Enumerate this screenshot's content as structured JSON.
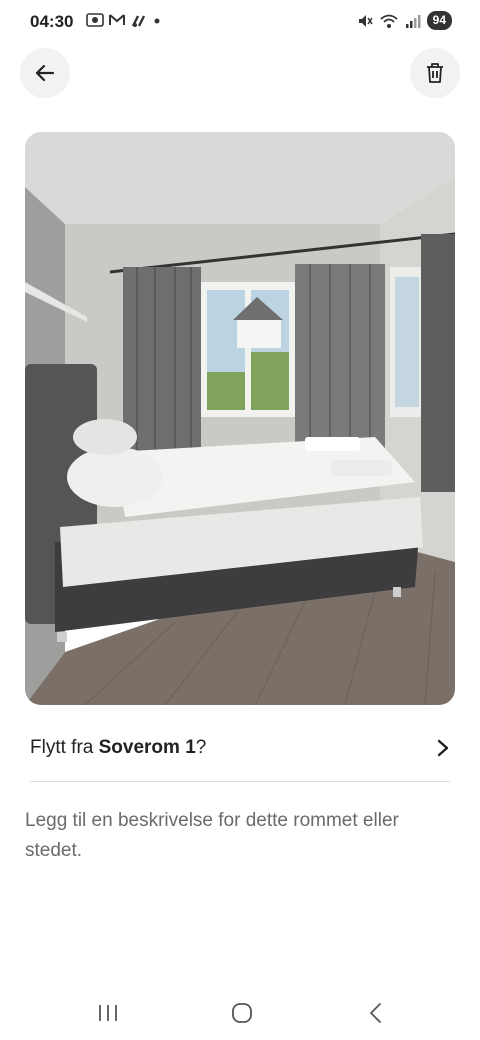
{
  "status_bar": {
    "time": "04:30",
    "battery": "94",
    "icons": [
      "screenshot-icon",
      "gmail-icon",
      "music-icon",
      "dot-icon",
      "mute-icon",
      "wifi-icon",
      "signal-icon",
      "battery-icon"
    ]
  },
  "header": {
    "back_icon": "arrow-left-icon",
    "delete_icon": "trash-icon"
  },
  "photo": {
    "subject": "bedroom-photo"
  },
  "move_row": {
    "prefix": "Flytt fra ",
    "room": "Soverom 1",
    "suffix": "?",
    "icon": "chevron-right-icon"
  },
  "description": {
    "placeholder": "Legg til en beskrivelse for dette rommet eller stedet."
  },
  "nav_bar": {
    "icons": [
      "recent-apps-icon",
      "home-icon",
      "back-nav-icon"
    ]
  },
  "colors": {
    "text": "#222222",
    "muted": "#6a6a6a",
    "button_bg": "#f2f2f2",
    "divider": "#dddddd"
  }
}
